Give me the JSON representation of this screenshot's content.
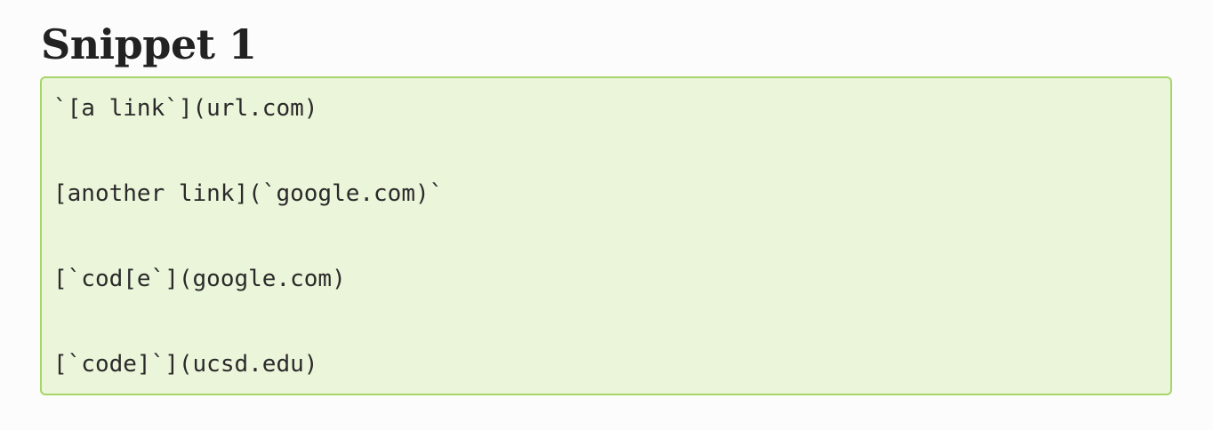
{
  "snippet": {
    "title": "Snippet 1",
    "lines": [
      "`[a link`](url.com)",
      "[another link](`google.com)`",
      "[`cod[e`](google.com)",
      "[`code]`](ucsd.edu)"
    ]
  },
  "colors": {
    "background": "#fcfcfc",
    "code_background": "#ebf5d9",
    "code_border": "#a6d669",
    "text": "#222222"
  }
}
